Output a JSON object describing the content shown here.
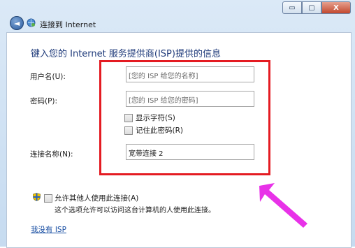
{
  "window": {
    "title": "连接到 Internet",
    "controls": {
      "minimize": "▭",
      "maximize": "▢",
      "close": "X"
    }
  },
  "nav": {
    "back_glyph": "◄"
  },
  "form": {
    "heading": "键入您的 Internet 服务提供商(ISP)提供的信息",
    "username_label": "用户名(U):",
    "username_placeholder": "[您的 ISP 给您的名称]",
    "password_label": "密码(P):",
    "password_placeholder": "[您的 ISP 给您的密码]",
    "show_chars_label": "显示字符(S)",
    "remember_password_label": "记住此密码(R)",
    "connection_name_label": "连接名称(N):",
    "connection_name_value": "宽带连接 2"
  },
  "sharing": {
    "allow_others_label": "允许其他人使用此连接(A)",
    "allow_others_desc": "这个选项允许可以访问这台计算机的人使用此连接。"
  },
  "links": {
    "no_isp": "我没有 ISP"
  },
  "icons": [
    "back-arrow-icon",
    "globe-icon",
    "shield-icon",
    "checkbox-icon"
  ],
  "colors": {
    "highlight_box": "#e41b22",
    "annotation_arrow": "#e832e8",
    "heading": "#1e3a7a",
    "link": "#1a4fa3"
  }
}
